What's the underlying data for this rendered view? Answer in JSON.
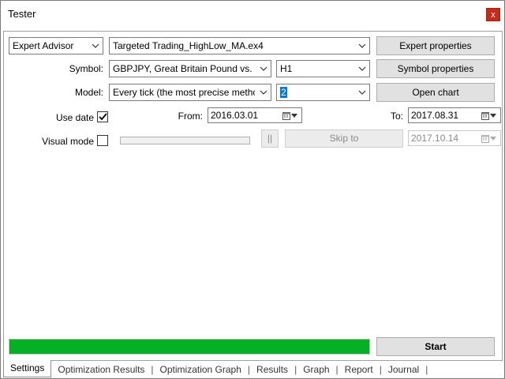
{
  "window": {
    "title": "Tester",
    "close_glyph": "x"
  },
  "settings": {
    "mode": "Expert Advisor",
    "expert_file": "Targeted Trading_HighLow_MA.ex4",
    "expert_properties_label": "Expert properties",
    "symbol_label": "Symbol:",
    "symbol_value": "GBPJPY, Great Britain Pound vs. Japa",
    "period_value": "H1",
    "symbol_properties_label": "Symbol properties",
    "model_label": "Model:",
    "model_value": "Every tick (the most precise method ba",
    "spread_value": "2",
    "open_chart_label": "Open chart",
    "use_date_label": "Use date",
    "use_date_checked": true,
    "from_label": "From:",
    "from_date": "2016.03.01",
    "to_label": "To:",
    "to_date": "2017.08.31",
    "visual_mode_label": "Visual mode",
    "visual_mode_checked": false,
    "pause_glyph": "||",
    "skip_to_label": "Skip to",
    "skip_to_date": "2017.10.14",
    "progress": 1.0,
    "progress_color": "#06b025",
    "start_label": "Start"
  },
  "tabs": [
    {
      "label": "Settings",
      "active": true
    },
    {
      "label": "Optimization Results",
      "active": false
    },
    {
      "label": "Optimization Graph",
      "active": false
    },
    {
      "label": "Results",
      "active": false
    },
    {
      "label": "Graph",
      "active": false
    },
    {
      "label": "Report",
      "active": false
    },
    {
      "label": "Journal",
      "active": false
    }
  ]
}
